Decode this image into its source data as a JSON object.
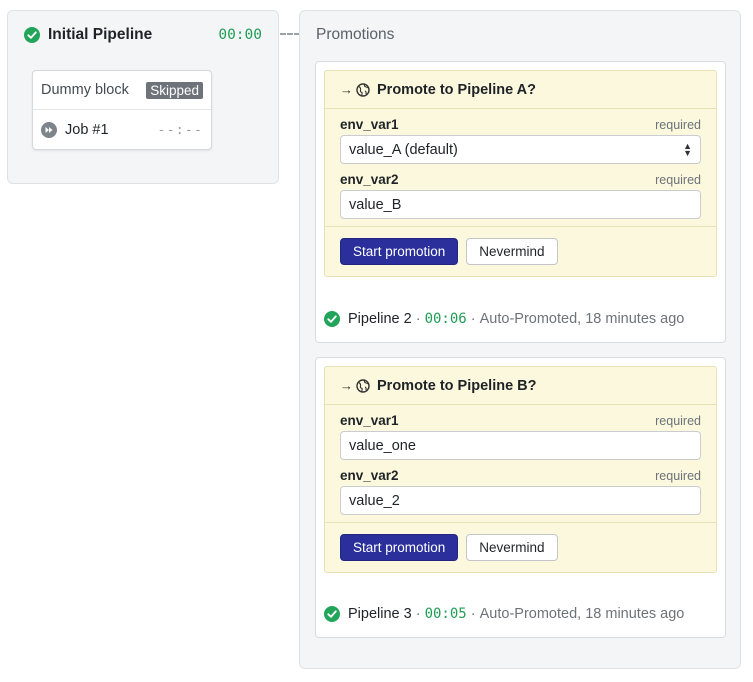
{
  "pipeline": {
    "title": "Initial Pipeline",
    "duration": "00:00",
    "status_color": "#22a55b",
    "block": {
      "name": "Dummy block",
      "badge": "Skipped",
      "job": {
        "label": "Job #1",
        "duration": "--:--",
        "icon": "skip-icon"
      }
    }
  },
  "promotions": {
    "title": "Promotions",
    "items": [
      {
        "title": "Promote to Pipeline A?",
        "fields": [
          {
            "name": "env_var1",
            "required_label": "required",
            "value": "value_A (default)",
            "type": "select"
          },
          {
            "name": "env_var2",
            "required_label": "required",
            "value": "value_B",
            "type": "text"
          }
        ],
        "start_label": "Start promotion",
        "cancel_label": "Nevermind",
        "result": {
          "pipeline": "Pipeline 2",
          "duration": "00:06",
          "meta": "Auto-Promoted, 18 minutes ago"
        }
      },
      {
        "title": "Promote to Pipeline B?",
        "fields": [
          {
            "name": "env_var1",
            "required_label": "required",
            "value": "value_one",
            "type": "text"
          },
          {
            "name": "env_var2",
            "required_label": "required",
            "value": "value_2",
            "type": "text"
          }
        ],
        "start_label": "Start promotion",
        "cancel_label": "Nevermind",
        "result": {
          "pipeline": "Pipeline 3",
          "duration": "00:05",
          "meta": "Auto-Promoted, 18 minutes ago"
        }
      }
    ]
  },
  "colors": {
    "accent": "#2a2f9c",
    "success": "#22a55b",
    "time": "#1f9d55",
    "form_bg": "#fbf8dd"
  }
}
